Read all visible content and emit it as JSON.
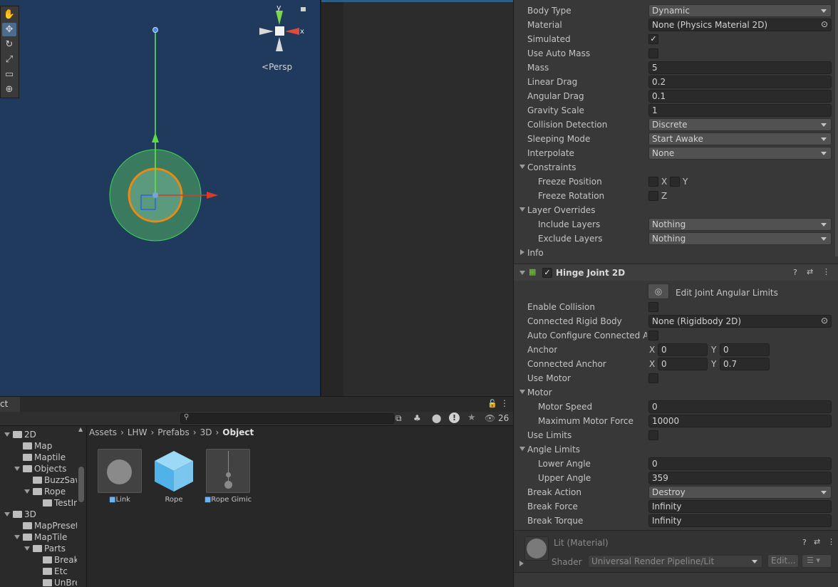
{
  "scene": {
    "persp_label": "Persp",
    "gizmo_axes": {
      "y": "y",
      "x": "x"
    },
    "tools": [
      "hand-tool",
      "move-tool",
      "rotate-tool",
      "scale-tool",
      "rect-tool",
      "transform-tool"
    ]
  },
  "project": {
    "tab_label": "ct",
    "hidden_count": "26",
    "breadcrumb": [
      "Assets",
      "LHW",
      "Prefabs",
      "3D",
      "Object"
    ],
    "folders": [
      {
        "label": "2D",
        "indent": 0,
        "expanded": true
      },
      {
        "label": "Map",
        "indent": 1,
        "expanded": false
      },
      {
        "label": "Maptile",
        "indent": 1,
        "expanded": false
      },
      {
        "label": "Objects",
        "indent": 1,
        "expanded": true
      },
      {
        "label": "BuzzSaw",
        "indent": 2,
        "expanded": false
      },
      {
        "label": "Rope",
        "indent": 2,
        "expanded": true
      },
      {
        "label": "TestIma",
        "indent": 3,
        "expanded": false
      },
      {
        "label": "3D",
        "indent": 0,
        "expanded": true
      },
      {
        "label": "MapPreset",
        "indent": 1,
        "expanded": false
      },
      {
        "label": "MapTile",
        "indent": 1,
        "expanded": true
      },
      {
        "label": "Parts",
        "indent": 2,
        "expanded": true
      },
      {
        "label": "Breaka",
        "indent": 3,
        "expanded": false
      },
      {
        "label": "Etc",
        "indent": 3,
        "expanded": false
      },
      {
        "label": "UnBrea",
        "indent": 3,
        "expanded": false
      }
    ],
    "assets": [
      {
        "label": "Link"
      },
      {
        "label": "Rope"
      },
      {
        "label": "Rope Gimic"
      }
    ]
  },
  "rigidbody": {
    "body_type_label": "Body Type",
    "body_type": "Dynamic",
    "material_label": "Material",
    "material": "None (Physics Material 2D)",
    "simulated_label": "Simulated",
    "auto_mass_label": "Use Auto Mass",
    "mass_label": "Mass",
    "mass": "5",
    "linear_drag_label": "Linear Drag",
    "linear_drag": "0.2",
    "angular_drag_label": "Angular Drag",
    "angular_drag": "0.1",
    "gravity_label": "Gravity Scale",
    "gravity": "1",
    "collision_label": "Collision Detection",
    "collision": "Discrete",
    "sleeping_label": "Sleeping Mode",
    "sleeping": "Start Awake",
    "interpolate_label": "Interpolate",
    "interpolate": "None",
    "constraints_label": "Constraints",
    "freeze_pos_label": "Freeze Position",
    "freeze_rot_label": "Freeze Rotation",
    "x": "X",
    "y": "Y",
    "z": "Z",
    "layer_overrides_label": "Layer Overrides",
    "include_label": "Include Layers",
    "include": "Nothing",
    "exclude_label": "Exclude Layers",
    "exclude": "Nothing",
    "info_label": "Info"
  },
  "hinge": {
    "title": "Hinge Joint 2D",
    "edit_limits": "Edit Joint Angular Limits",
    "enable_collision_label": "Enable Collision",
    "connected_rb_label": "Connected Rigid Body",
    "connected_rb": "None (Rigidbody 2D)",
    "auto_config_label": "Auto Configure Connected An",
    "anchor_label": "Anchor",
    "anchor_x": "0",
    "anchor_y": "0",
    "connected_anchor_label": "Connected Anchor",
    "connected_anchor_x": "0",
    "connected_anchor_y": "0.7",
    "use_motor_label": "Use Motor",
    "motor_label": "Motor",
    "motor_speed_label": "Motor Speed",
    "motor_speed": "0",
    "max_force_label": "Maximum Motor Force",
    "max_force": "10000",
    "use_limits_label": "Use Limits",
    "angle_limits_label": "Angle Limits",
    "lower_label": "Lower Angle",
    "lower": "0",
    "upper_label": "Upper Angle",
    "upper": "359",
    "break_action_label": "Break Action",
    "break_action": "Destroy",
    "break_force_label": "Break Force",
    "break_force": "Infinity",
    "break_torque_label": "Break Torque",
    "break_torque": "Infinity"
  },
  "material": {
    "title": "Lit (Material)",
    "shader_label": "Shader",
    "shader": "Universal Render Pipeline/Lit",
    "edit": "Edit..."
  }
}
